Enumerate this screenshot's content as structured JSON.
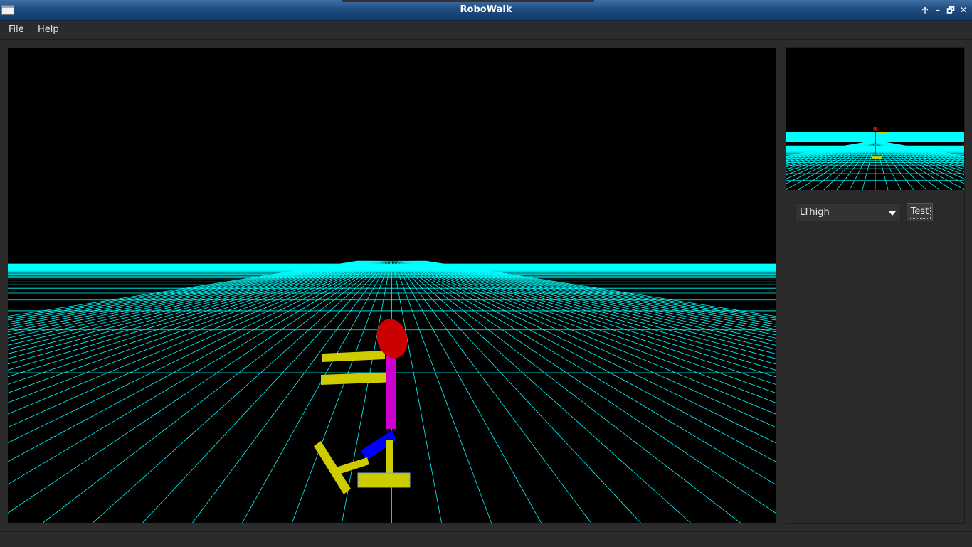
{
  "window": {
    "title": "RoboWalk",
    "controls": {
      "up": "🡡",
      "minimize": "–",
      "maximize": "🗗",
      "close": "✕"
    }
  },
  "menu": {
    "items": [
      {
        "label": "File"
      },
      {
        "label": "Help"
      }
    ]
  },
  "colors": {
    "grid": "#00ffff",
    "sky": "#000000",
    "head": "#cc0000",
    "spine": "#cc00cc",
    "limbs": "#cccc00",
    "joint": "#0000ff"
  },
  "controls": {
    "part_select": {
      "value": "LThigh"
    },
    "test_label": "Test"
  }
}
